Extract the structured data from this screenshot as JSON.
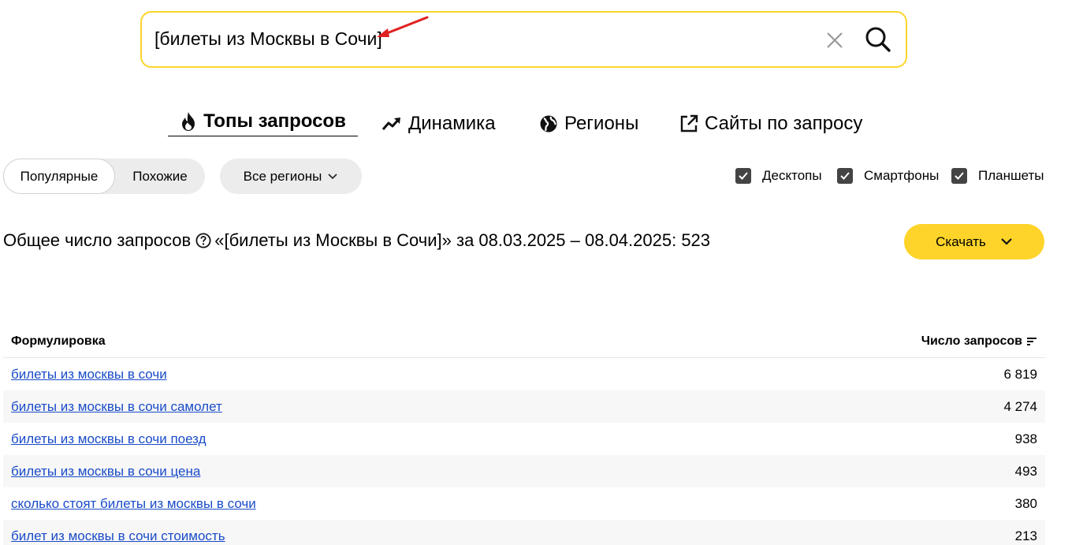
{
  "search": {
    "value": "[билеты из Москвы в Сочи]",
    "clear_icon": "close-icon",
    "submit_icon": "search-icon",
    "border_color": "#fed42b"
  },
  "tabs": [
    {
      "label": "Топы запросов",
      "icon": "fire-icon",
      "active": true
    },
    {
      "label": "Динамика",
      "icon": "trend-icon",
      "active": false
    },
    {
      "label": "Регионы",
      "icon": "globe-icon",
      "active": false
    },
    {
      "label": "Сайты по запросу",
      "icon": "external-link-icon",
      "active": false
    }
  ],
  "filters": {
    "mode_options": [
      "Популярные",
      "Похожие"
    ],
    "mode_selected": "Популярные",
    "region": "Все регионы",
    "devices": [
      {
        "label": "Десктопы",
        "checked": true
      },
      {
        "label": "Смартфоны",
        "checked": true
      },
      {
        "label": "Планшеты",
        "checked": true
      }
    ]
  },
  "summary": {
    "label": "Общее число запросов",
    "text": "«[билеты из Москвы в Сочи]» за 08.03.2025 – 08.04.2025: 523"
  },
  "download": {
    "label": "Скачать",
    "color": "#fed42b"
  },
  "table": {
    "headers": {
      "phrase": "Формулировка",
      "count": "Число запросов"
    },
    "rows": [
      {
        "phrase": "билеты из москвы в сочи",
        "count": "6 819"
      },
      {
        "phrase": "билеты из москвы в сочи самолет",
        "count": "4 274"
      },
      {
        "phrase": "билеты из москвы в сочи поезд",
        "count": "938"
      },
      {
        "phrase": "билеты из москвы в сочи цена",
        "count": "493"
      },
      {
        "phrase": "сколько стоят билеты из москвы в сочи",
        "count": "380"
      },
      {
        "phrase": "билет из москвы в сочи стоимость",
        "count": "213"
      }
    ],
    "link_color": "#1a4cc8"
  }
}
